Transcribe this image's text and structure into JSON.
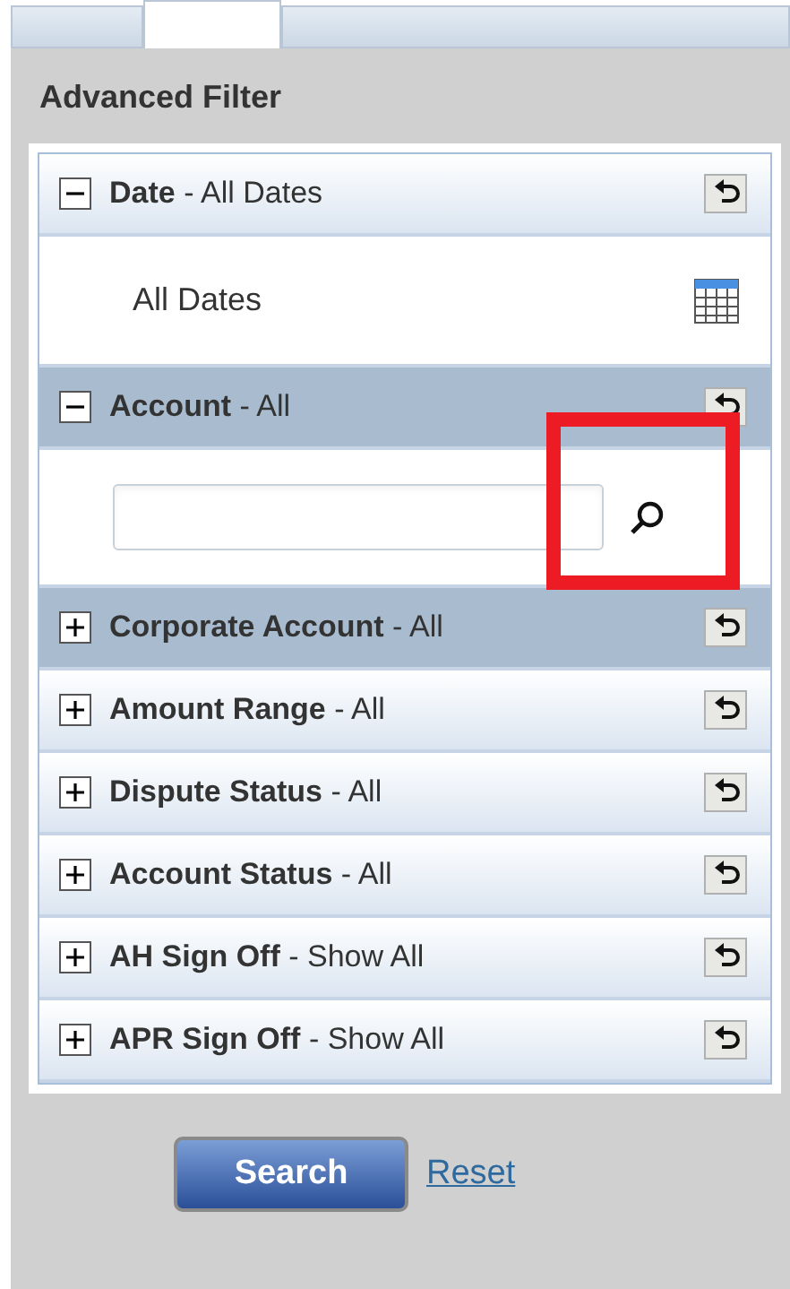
{
  "tabs": [
    {
      "selected": false
    },
    {
      "selected": true
    },
    {
      "selected": false
    }
  ],
  "title": "Advanced Filter",
  "sections": [
    {
      "heading": "**Date** - All Dates",
      "expanded": true,
      "highlighted": false,
      "body": {
        "kind": "date",
        "text": "All Dates"
      }
    },
    {
      "heading": "**Account** - All",
      "expanded": true,
      "highlighted": true,
      "body": {
        "kind": "search"
      }
    },
    {
      "heading": "**Corporate Account** - All",
      "expanded": false,
      "highlighted": true
    },
    {
      "heading": "**Amount Range** - All",
      "expanded": false,
      "highlighted": false
    },
    {
      "heading": "**Dispute Status** - All",
      "expanded": false,
      "highlighted": false
    },
    {
      "heading": "**Account Status** - All",
      "expanded": false,
      "highlighted": false
    },
    {
      "heading": "**AH Sign Off** - Show All",
      "expanded": false,
      "highlighted": false
    },
    {
      "heading": "**APR Sign Off** - Show All",
      "expanded": false,
      "highlighted": false
    }
  ],
  "search_button": "Search",
  "reset_link": "Reset",
  "annotation": {
    "kind": "rectangle"
  }
}
